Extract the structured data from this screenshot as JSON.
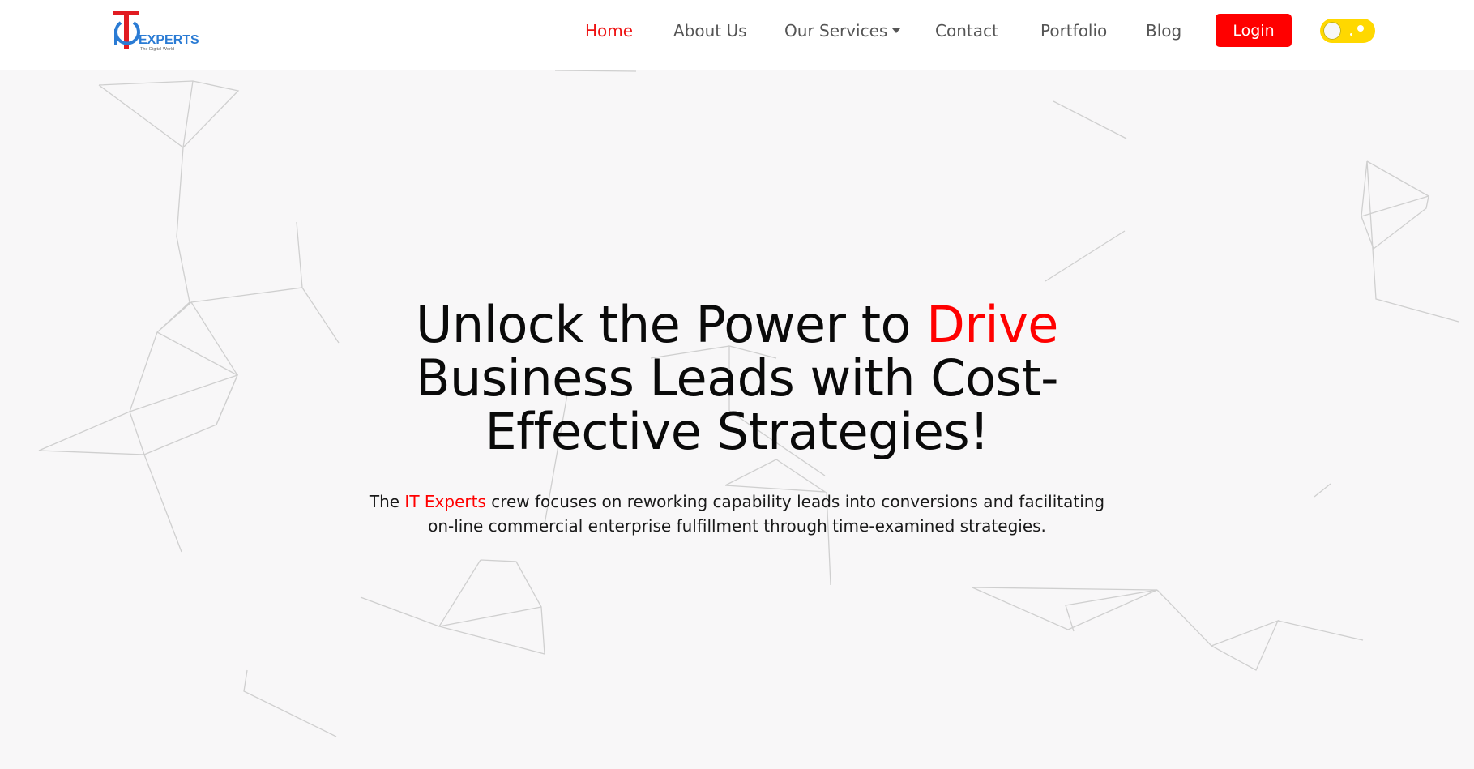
{
  "brand": {
    "logo_text": "EXPERTS",
    "logo_tagline": "The Digital World",
    "colors": {
      "accent": "#ff0000",
      "blue": "#2a7bd4",
      "toggle": "#ffd800"
    }
  },
  "nav": {
    "items": [
      {
        "label": "Home",
        "active": true
      },
      {
        "label": "About Us"
      },
      {
        "label": "Our Services",
        "dropdown": true
      },
      {
        "label": "Contact"
      },
      {
        "label": "Portfolio"
      },
      {
        "label": "Blog"
      }
    ],
    "login_label": "Login",
    "theme_toggle": {
      "icon": "toggle-switch-icon",
      "state": "off"
    }
  },
  "hero": {
    "title_part1": "Unlock the Power to ",
    "title_accent": "Drive",
    "title_part2": "Business Leads with Cost-Effective Strategies!",
    "subtitle_before": "The ",
    "subtitle_accent": "IT Experts",
    "subtitle_after": " crew focuses on reworking capability leads into conversions and facilitating on-line commercial enterprise fulfillment through time-examined strategies."
  }
}
